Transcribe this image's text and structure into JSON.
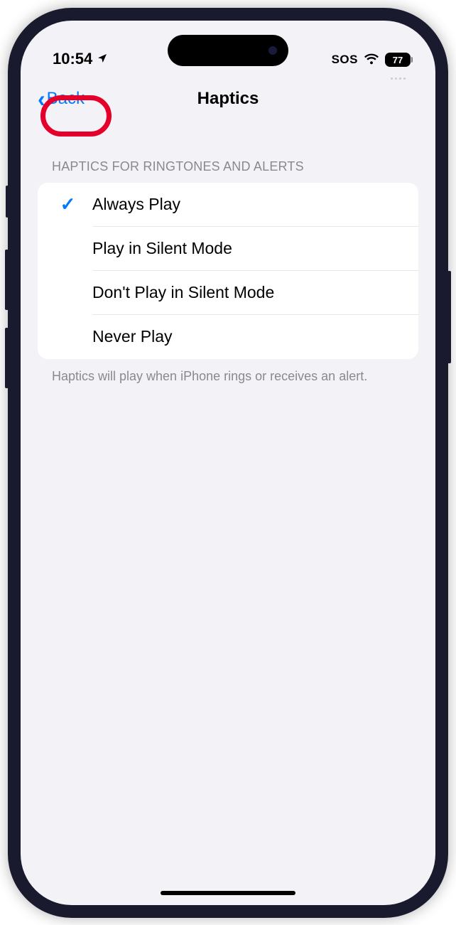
{
  "status_bar": {
    "time": "10:54",
    "sos": "SOS",
    "battery": "77"
  },
  "nav": {
    "back_label": "Back",
    "title": "Haptics"
  },
  "section": {
    "header": "HAPTICS FOR RINGTONES AND ALERTS",
    "footer": "Haptics will play when iPhone rings or receives an alert."
  },
  "options": [
    {
      "label": "Always Play",
      "selected": true
    },
    {
      "label": "Play in Silent Mode",
      "selected": false
    },
    {
      "label": "Don't Play in Silent Mode",
      "selected": false
    },
    {
      "label": "Never Play",
      "selected": false
    }
  ]
}
